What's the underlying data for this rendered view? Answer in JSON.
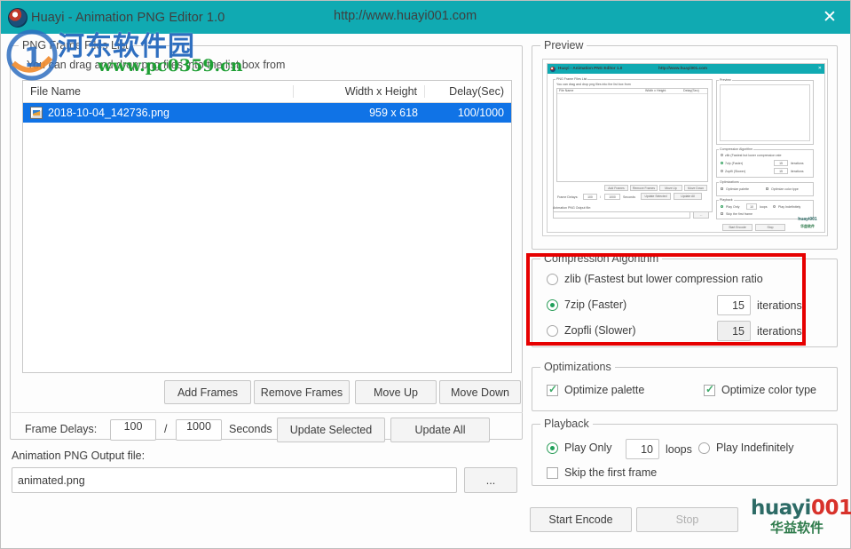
{
  "window": {
    "title": "Huayi - Animation PNG Editor 1.0",
    "url": "http://www.huayi001.com",
    "close_label": "✕",
    "titlebar_color": "#10aab2"
  },
  "watermark": {
    "site_cn": "河东软件园",
    "site_url": "www.pc0359.cn",
    "badge_text": "1",
    "cn_color": "#2f6fc0",
    "url_color": "#1f9f35"
  },
  "frames_panel": {
    "legend": "PNG Frame Files List",
    "hint": "You can drag and drop png files into the list box from",
    "columns": [
      "File Name",
      "Width x Height",
      "Delay(Sec)"
    ],
    "rows": [
      {
        "icon": "image-file-icon",
        "name": "2018-10-04_142736.png",
        "size": "959 x 618",
        "delay": "100/1000",
        "selected": true
      }
    ],
    "selection_color": "#1073e6",
    "buttons": {
      "add": "Add Frames",
      "remove": "Remove Frames",
      "move_up": "Move Up",
      "move_down": "Move Down"
    },
    "delays": {
      "label": "Frame Delays:",
      "numerator": "100",
      "separator": "/",
      "denominator": "1000",
      "unit": "Seconds",
      "update_selected": "Update Selected",
      "update_all": "Update All"
    }
  },
  "output": {
    "label": "Animation PNG Output file:",
    "value": "animated.png",
    "browse_label": "..."
  },
  "preview": {
    "legend": "Preview",
    "mini": {
      "title": "Huayi - Animation PNG Editor 1.0",
      "url": "http://www.huayi001.com",
      "close": "✕",
      "frames_legend": "PNG Frame Files List",
      "hint": "You can drag and drop png files into the list box from",
      "col_name": "File Name",
      "col_size": "Width x Height",
      "col_delay": "Delay(Sec)",
      "btn_add": "Add Frames",
      "btn_remove": "Remove Frames",
      "btn_up": "Move Up",
      "btn_down": "Move Down",
      "delay_label": "Frame Delays:",
      "delay_num": "100",
      "delay_sep": "/",
      "delay_den": "1000",
      "delay_unit": "Seconds",
      "btn_upd_sel": "Update Selected",
      "btn_upd_all": "Update All",
      "out_label": "Animation PNG Output file:",
      "out_value": "",
      "btn_browse": "...",
      "preview_legend": "Preview",
      "compress_legend": "Compression Algorithm",
      "opt_zlib": "zlib (Fastest but lower compression rate",
      "opt_7zip": "7zip (Faster)",
      "opt_zopfli": "Zopfli (Slower)",
      "iter_7zip": "15",
      "iter_zopfli": "15",
      "iter_label": "iterations",
      "optim_legend": "Optimizations",
      "opt_palette": "Optimize palette",
      "opt_colortype": "Optimize color type",
      "playback_legend": "Playback",
      "play_only": "Play Only",
      "loops_value": "10",
      "loops_label": "loops",
      "play_indef": "Play Indefinitely",
      "skip_first": "Skip the first frame",
      "btn_start": "Start Encode",
      "btn_stop": "Stop",
      "brand_top": "huayi001",
      "brand_bot": "华益软件"
    }
  },
  "compression": {
    "legend": "Compression Algorithm",
    "highlight_color": "#e60000",
    "options": [
      {
        "label": "zlib (Fastest but lower compression ratio",
        "selected": false,
        "iterations": null
      },
      {
        "label": "7zip (Faster)",
        "selected": true,
        "iterations": "15"
      },
      {
        "label": "Zopfli (Slower)",
        "selected": false,
        "iterations": "15"
      }
    ],
    "iterations_label": "iterations"
  },
  "optimizations": {
    "legend": "Optimizations",
    "items": [
      {
        "label": "Optimize palette",
        "checked": true
      },
      {
        "label": "Optimize color type",
        "checked": true
      }
    ]
  },
  "playback": {
    "legend": "Playback",
    "play_only_label": "Play Only",
    "loops_value": "10",
    "loops_label": "loops",
    "play_indefinitely_label": "Play Indefinitely",
    "play_only_selected": true,
    "skip_first_frame_label": "Skip the first frame",
    "skip_first_frame_checked": false
  },
  "actions": {
    "start_label": "Start Encode",
    "stop_label": "Stop",
    "stop_disabled": true
  },
  "brand": {
    "name_main": "huayi",
    "name_suffix": "001",
    "name_cn": "华益软件",
    "main_color": "#2d6b66",
    "suffix_color": "#d8322b"
  }
}
